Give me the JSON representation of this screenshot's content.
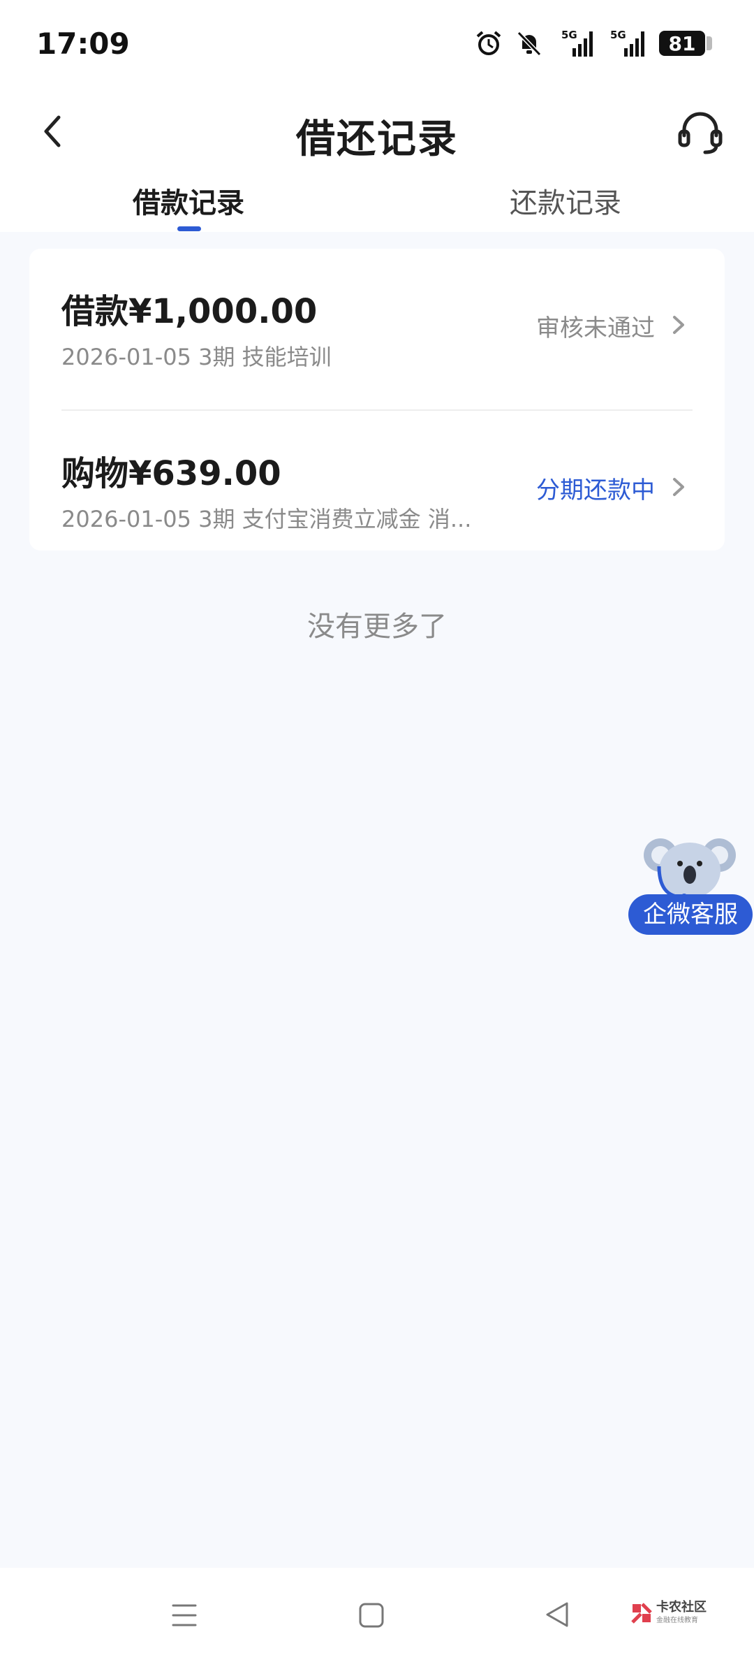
{
  "status_bar": {
    "time": "17:09",
    "network_1": "5G",
    "network_2": "5G",
    "battery": "81"
  },
  "nav": {
    "title": "借还记录"
  },
  "tabs": [
    {
      "label": "借款记录",
      "active": true
    },
    {
      "label": "还款记录",
      "active": false
    }
  ],
  "records": [
    {
      "amount": "借款¥1,000.00",
      "detail": "2026-01-05 3期  技能培训",
      "status": "审核未通过",
      "status_color": "#8a8a8a"
    },
    {
      "amount": "购物¥639.00",
      "detail": "2026-01-05 3期  支付宝消费立减金 消...",
      "status": "分期还款中",
      "status_color": "#2d5bd4"
    }
  ],
  "list_end": "没有更多了",
  "float_service": {
    "label": "企微客服"
  },
  "watermark": {
    "name": "卡农社区",
    "sub": "金融在线教育"
  },
  "colors": {
    "accent": "#2d5bd4",
    "background": "#f7f9fd"
  }
}
